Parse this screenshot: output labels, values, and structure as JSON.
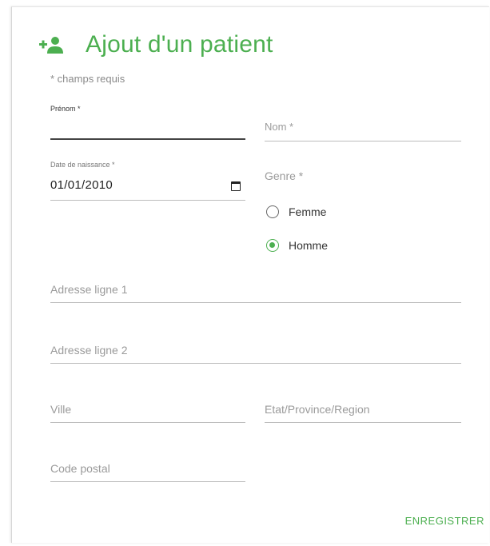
{
  "form": {
    "title": "Ajout d'un patient",
    "required_note": "* champs requis",
    "prenom": {
      "label": "Prénom *",
      "value": ""
    },
    "nom": {
      "placeholder": "Nom *"
    },
    "date_naissance": {
      "label": "Date de naissance *",
      "value": "01/01/2010"
    },
    "genre": {
      "label": "Genre *",
      "options": [
        {
          "label": "Femme",
          "checked": false
        },
        {
          "label": "Homme",
          "checked": true
        }
      ]
    },
    "adresse1": {
      "placeholder": "Adresse ligne 1"
    },
    "adresse2": {
      "placeholder": "Adresse ligne 2"
    },
    "ville": {
      "placeholder": "Ville"
    },
    "etat": {
      "placeholder": "Etat/Province/Region"
    },
    "code_postal": {
      "placeholder": "Code postal"
    },
    "save_label": "ENREGISTRER"
  },
  "icons": {
    "title": "person-add-icon",
    "calendar": "calendar-icon"
  },
  "colors": {
    "accent": "#4caf50",
    "text": "#222222",
    "muted": "#9a9a9a"
  }
}
